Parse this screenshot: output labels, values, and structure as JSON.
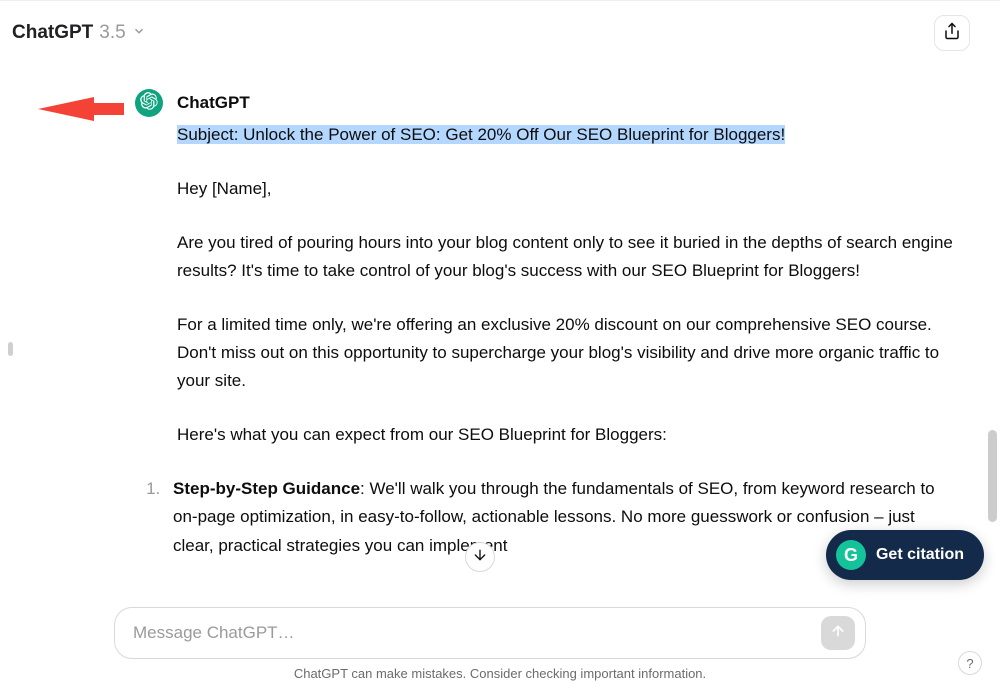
{
  "header": {
    "model_name": "ChatGPT",
    "model_version": "3.5"
  },
  "message": {
    "author": "ChatGPT",
    "subject_line": "Subject: Unlock the Power of SEO: Get 20% Off Our SEO Blueprint for Bloggers!",
    "greeting": "Hey [Name],",
    "para1": "Are you tired of pouring hours into your blog content only to see it buried in the depths of search engine results? It's time to take control of your blog's success with our SEO Blueprint for Bloggers!",
    "para2": "For a limited time only, we're offering an exclusive 20% discount on our comprehensive SEO course. Don't miss out on this opportunity to supercharge your blog's visibility and drive more organic traffic to your site.",
    "para3": "Here's what you can expect from our SEO Blueprint for Bloggers:",
    "list": [
      {
        "title": "Step-by-Step Guidance",
        "rest": ": We'll walk you through the fundamentals of SEO, from keyword research to on-page optimization, in easy-to-follow, actionable lessons. No more guesswork or confusion – just clear, practical strategies you can implement"
      }
    ]
  },
  "citation": {
    "label": "Get citation",
    "badge": "G"
  },
  "input": {
    "placeholder": "Message ChatGPT…"
  },
  "footer": {
    "disclaimer": "ChatGPT can make mistakes. Consider checking important information."
  },
  "help": {
    "icon": "?"
  }
}
